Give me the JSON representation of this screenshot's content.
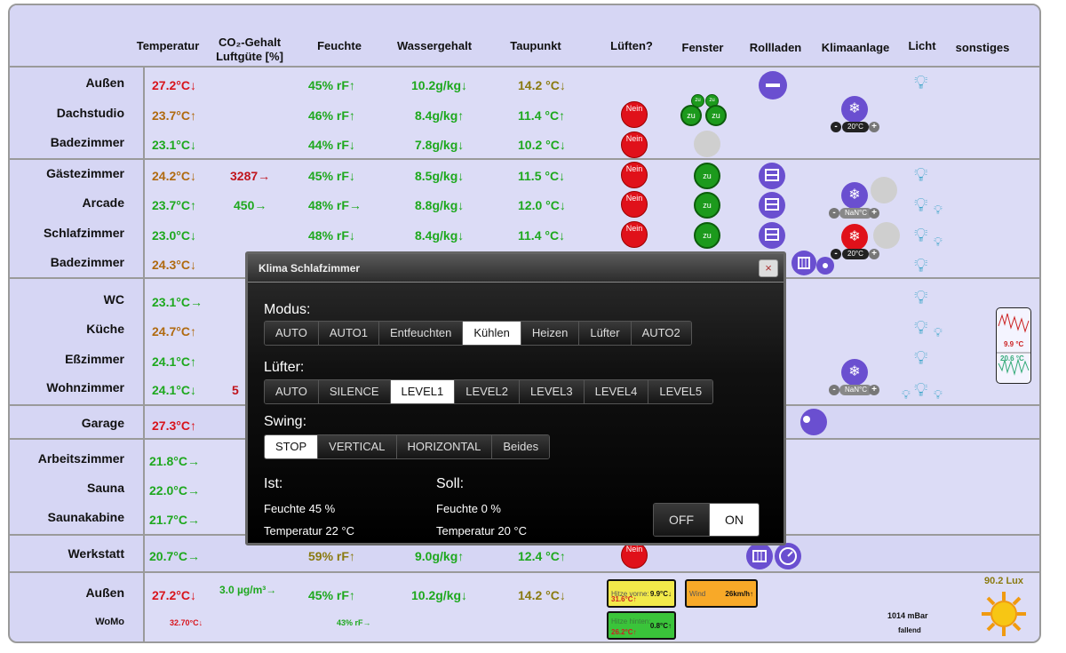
{
  "headers": [
    "Temperatur",
    "CO₂-Gehalt",
    "Luftgüte [%]",
    "Feuchte",
    "Wassergehalt",
    "Taupunkt",
    "Lüften?",
    "Fenster",
    "Rollladen",
    "Klimaanlage",
    "Licht",
    "sonstiges"
  ],
  "rooms": {
    "aussen": {
      "name": "Außen",
      "temp": "27.2°C↓",
      "feuchte": "45% rF↑",
      "wasser": "10.2g/kg↓",
      "taupunkt": "14.2 °C↓"
    },
    "dachstudio": {
      "name": "Dachstudio",
      "temp": "23.7°C↑",
      "feuchte": "46% rF↑",
      "wasser": "8.4g/kg↑",
      "taupunkt": "11.4 °C↑"
    },
    "bad1": {
      "name": "Badezimmer",
      "temp": "23.1°C↓",
      "feuchte": "44% rF↓",
      "wasser": "7.8g/kg↓",
      "taupunkt": "10.2 °C↓"
    },
    "gaeste": {
      "name": "Gästezimmer",
      "temp": "24.2°C↓",
      "co2": "3287→",
      "feuchte": "45% rF↓",
      "wasser": "8.5g/kg↓",
      "taupunkt": "11.5 °C↓"
    },
    "arcade": {
      "name": "Arcade",
      "temp": "23.7°C↑",
      "co2": "450→",
      "feuchte": "48% rF→",
      "wasser": "8.8g/kg↓",
      "taupunkt": "12.0 °C↓"
    },
    "schlaf": {
      "name": "Schlafzimmer",
      "temp": "23.0°C↓",
      "feuchte": "48% rF↓",
      "wasser": "8.4g/kg↓",
      "taupunkt": "11.4 °C↓"
    },
    "bad2": {
      "name": "Badezimmer",
      "temp": "24.3°C↓"
    },
    "wc": {
      "name": "WC",
      "temp": "23.1°C→"
    },
    "kueche": {
      "name": "Küche",
      "temp": "24.7°C↑"
    },
    "ess": {
      "name": "Eßzimmer",
      "temp": "24.1°C↑"
    },
    "wohn": {
      "name": "Wohnzimmer",
      "temp": "24.1°C↓",
      "co2": "5"
    },
    "garage": {
      "name": "Garage",
      "temp": "27.3°C↑"
    },
    "arbeit": {
      "name": "Arbeitszimmer",
      "temp": "21.8°C→"
    },
    "sauna": {
      "name": "Sauna",
      "temp": "22.0°C→"
    },
    "saunakabine": {
      "name": "Saunakabine",
      "temp": "21.7°C→"
    },
    "werkstatt": {
      "name": "Werkstatt",
      "temp": "20.7°C→",
      "feuchte": "59% rF↑",
      "wasser": "9.0g/kg↑",
      "taupunkt": "12.4 °C↑"
    },
    "aussen2": {
      "name": "Außen",
      "temp": "27.2°C↓",
      "co2": "3.0 µg/m³→",
      "feuchte": "45% rF↑",
      "wasser": "10.2g/kg↓",
      "taupunkt": "14.2 °C↓"
    },
    "womo": {
      "name": "WoMo",
      "temp": "32.70°C↓",
      "feuchte": "43% rF→"
    }
  },
  "badges": {
    "nein": "Nein",
    "zu": "zu",
    "ac1": "20°C",
    "ac2": "NaN°C",
    "ac3": "20°C",
    "ac4": "NaN°C",
    "snow": "❄"
  },
  "weather": {
    "hitze_label": "Hitze vorne:",
    "hitze_val1": "9.9°C↓",
    "hitze_val2": "31.6°C↑",
    "wind_label": "Wind",
    "wind_val": "26km/h↑",
    "hitze2_label": "Hitze hinten:",
    "hitze2_val1": "0.8°C↑",
    "hitze2_val2": "26.2°C↑",
    "lux": "90.2 Lux",
    "pressure": "1014 mBar",
    "pressure_trend": "fallend",
    "chart_red": "9.9 °C",
    "chart_green": "20.6 °C"
  },
  "modal": {
    "title": "Klima Schlafzimmer",
    "close": "×",
    "modus_label": "Modus:",
    "modus": [
      "AUTO",
      "AUTO1",
      "Entfeuchten",
      "Kühlen",
      "Heizen",
      "Lüfter",
      "AUTO2"
    ],
    "modus_selected": 3,
    "luefter_label": "Lüfter:",
    "luefter": [
      "AUTO",
      "SILENCE",
      "LEVEL1",
      "LEVEL2",
      "LEVEL3",
      "LEVEL4",
      "LEVEL5"
    ],
    "luefter_selected": 2,
    "swing_label": "Swing:",
    "swing": [
      "STOP",
      "VERTICAL",
      "HORIZONTAL",
      "Beides"
    ],
    "swing_selected": 0,
    "ist_label": "Ist:",
    "ist_feuchte": "Feuchte 45 %",
    "ist_temp": "Temperatur 22 °C",
    "soll_label": "Soll:",
    "soll_feuchte": "Feuchte 0 %",
    "soll_temp": "Temperatur 20 °C",
    "off": "OFF",
    "on": "ON",
    "power_state": "ON"
  },
  "colors": {
    "panel": "#d6d6f4",
    "accent": "#6a4fd0",
    "nein": "#e0111a",
    "zu": "#1c9a1c"
  }
}
